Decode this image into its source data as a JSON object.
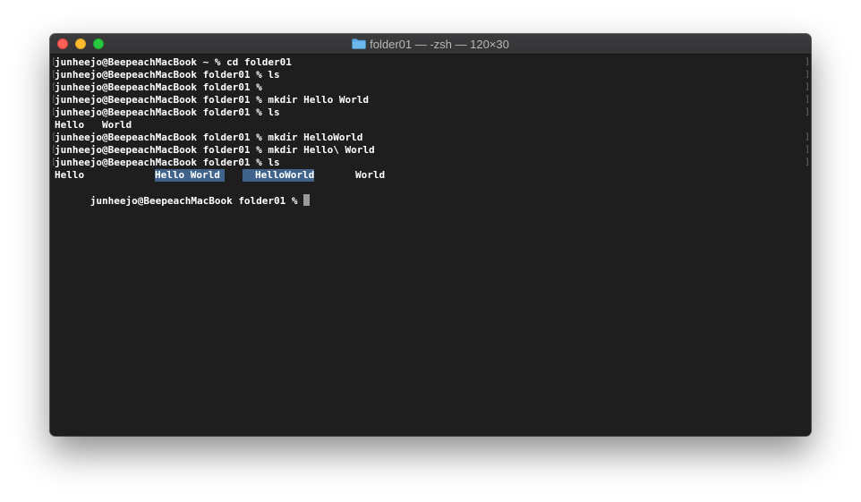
{
  "window": {
    "title": "folder01 — -zsh — 120×30",
    "folder_icon": "folder-icon",
    "colors": {
      "background": "#1e1e1e",
      "text": "#ffffff",
      "selection": "#3f638b",
      "close": "#fe5f57",
      "minimize": "#febc2e",
      "maximize": "#28c840"
    }
  },
  "terminal": {
    "lines": [
      "junheejo@BeepeachMacBook ~ % cd folder01",
      "junheejo@BeepeachMacBook folder01 % ls",
      "junheejo@BeepeachMacBook folder01 %",
      "junheejo@BeepeachMacBook folder01 % mkdir Hello World",
      "junheejo@BeepeachMacBook folder01 % ls",
      "Hello   World",
      "junheejo@BeepeachMacBook folder01 % mkdir HelloWorld",
      "junheejo@BeepeachMacBook folder01 % mkdir Hello\\ World",
      "junheejo@BeepeachMacBook folder01 % ls"
    ],
    "ls_output": {
      "item1": "Hello",
      "item2": "Hello World",
      "item3": "HelloWorld",
      "item4": "World"
    },
    "prompt": "junheejo@BeepeachMacBook folder01 % "
  }
}
